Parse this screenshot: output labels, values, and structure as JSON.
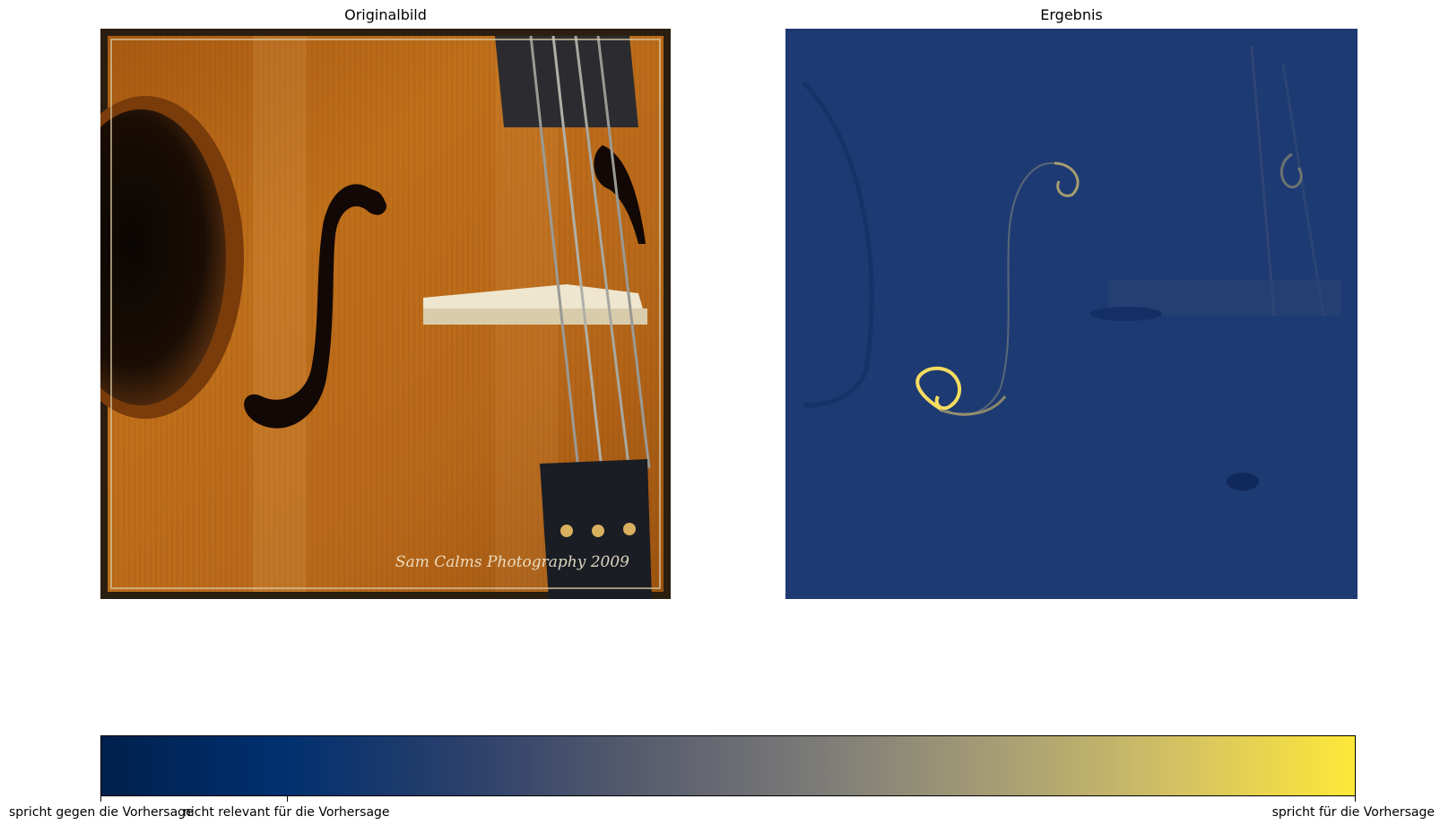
{
  "panels": {
    "left_title": "Originalbild",
    "right_title": "Ergebnis"
  },
  "photo": {
    "watermark": "Sam Calms Photography 2009"
  },
  "colorbar": {
    "tick_labels": [
      "spricht gegen die Vorhersage",
      "nicht relevant für die Vorhersage",
      "spricht für die Vorhersage"
    ],
    "colormap": [
      "#00204c",
      "#00306f",
      "#2a3f6b",
      "#575c6d",
      "#7c7b78",
      "#a69d75",
      "#d3c164",
      "#fee838"
    ]
  }
}
